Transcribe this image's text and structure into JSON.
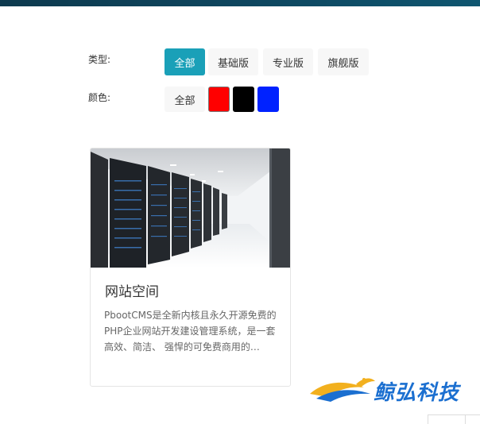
{
  "filters": {
    "type": {
      "label": "类型:",
      "options": [
        {
          "label": "全部",
          "active": true
        },
        {
          "label": "基础版",
          "active": false
        },
        {
          "label": "专业版",
          "active": false
        },
        {
          "label": "旗舰版",
          "active": false
        }
      ]
    },
    "color": {
      "label": "颜色:",
      "all_label": "全部",
      "swatches": [
        {
          "color": "#ff0000",
          "selected": true
        },
        {
          "color": "#000000",
          "selected": false
        },
        {
          "color": "#0022ff",
          "selected": false
        }
      ]
    }
  },
  "card": {
    "title": "网站空间",
    "description": "PbootCMS是全新内核且永久开源免费的PHP企业网站开发建设管理系统，是一套高效、简洁、 强悍的可免费商用的…",
    "image_icon": "server-room-image"
  },
  "watermark": {
    "text": "鲸弘科技",
    "accent_color": "#1b6fd0",
    "wave_color": "#f2b01e"
  },
  "colors": {
    "active_option": "#1aa0b8",
    "option_bg": "#f7f7f7"
  }
}
